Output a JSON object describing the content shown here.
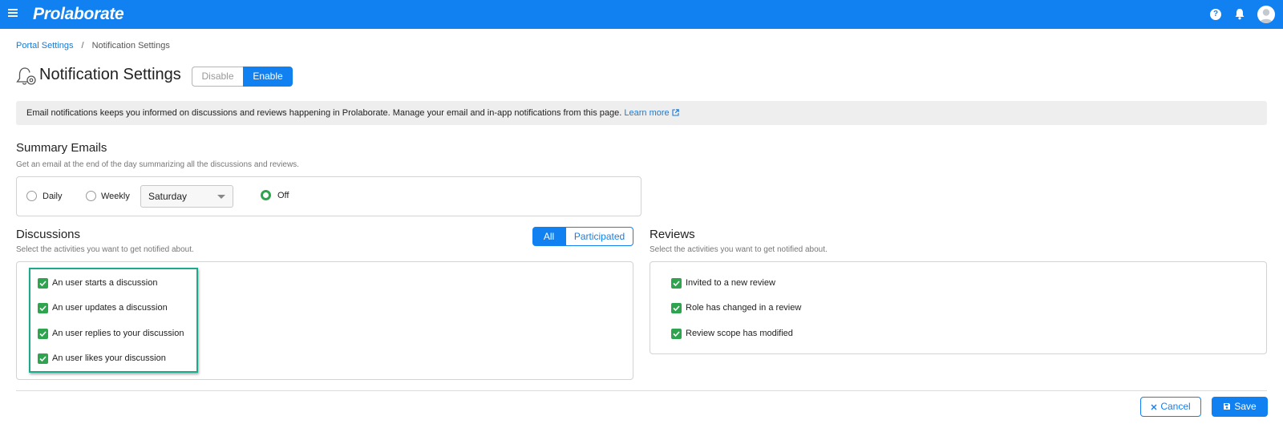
{
  "app": {
    "name": "Prolaborate"
  },
  "breadcrumb": {
    "parent": "Portal Settings",
    "separator": "/",
    "current": "Notification Settings"
  },
  "page": {
    "title": "Notification Settings"
  },
  "toggle": {
    "disable_label": "Disable",
    "enable_label": "Enable",
    "selected": "Enable"
  },
  "info": {
    "text": "Email notifications keeps you informed on discussions and reviews happening in Prolaborate. Manage your email and in-app notifications from this page.",
    "link_label": "Learn more"
  },
  "summary": {
    "title": "Summary Emails",
    "subtitle": "Get an email at the end of the day summarizing all the discussions and reviews.",
    "options": {
      "daily": "Daily",
      "weekly": "Weekly",
      "off": "Off"
    },
    "selected": "Off",
    "weekday_value": "Saturday"
  },
  "discussions": {
    "title": "Discussions",
    "subtitle": "Select the activities you want to get notified about.",
    "filter": {
      "all": "All",
      "participated": "Participated",
      "selected": "All"
    },
    "items": [
      {
        "label": "An user starts a discussion",
        "checked": true
      },
      {
        "label": "An user updates a discussion",
        "checked": true
      },
      {
        "label": "An user replies to your discussion",
        "checked": true
      },
      {
        "label": "An user likes your discussion",
        "checked": true
      }
    ]
  },
  "reviews": {
    "title": "Reviews",
    "subtitle": "Select the activities you want to get notified about.",
    "items": [
      {
        "label": "Invited to a new review",
        "checked": true
      },
      {
        "label": "Role has changed in a review",
        "checked": true
      },
      {
        "label": "Review scope has modified",
        "checked": true
      }
    ]
  },
  "footer": {
    "cancel_label": "Cancel",
    "save_label": "Save"
  },
  "colors": {
    "primary": "#1180f0",
    "check_green": "#2ea44f",
    "highlight": "#1fa98a"
  },
  "icons": [
    "menu-icon",
    "help-icon",
    "bell-icon",
    "avatar-icon",
    "notification-settings-icon",
    "external-link-icon",
    "close-icon",
    "save-icon"
  ]
}
